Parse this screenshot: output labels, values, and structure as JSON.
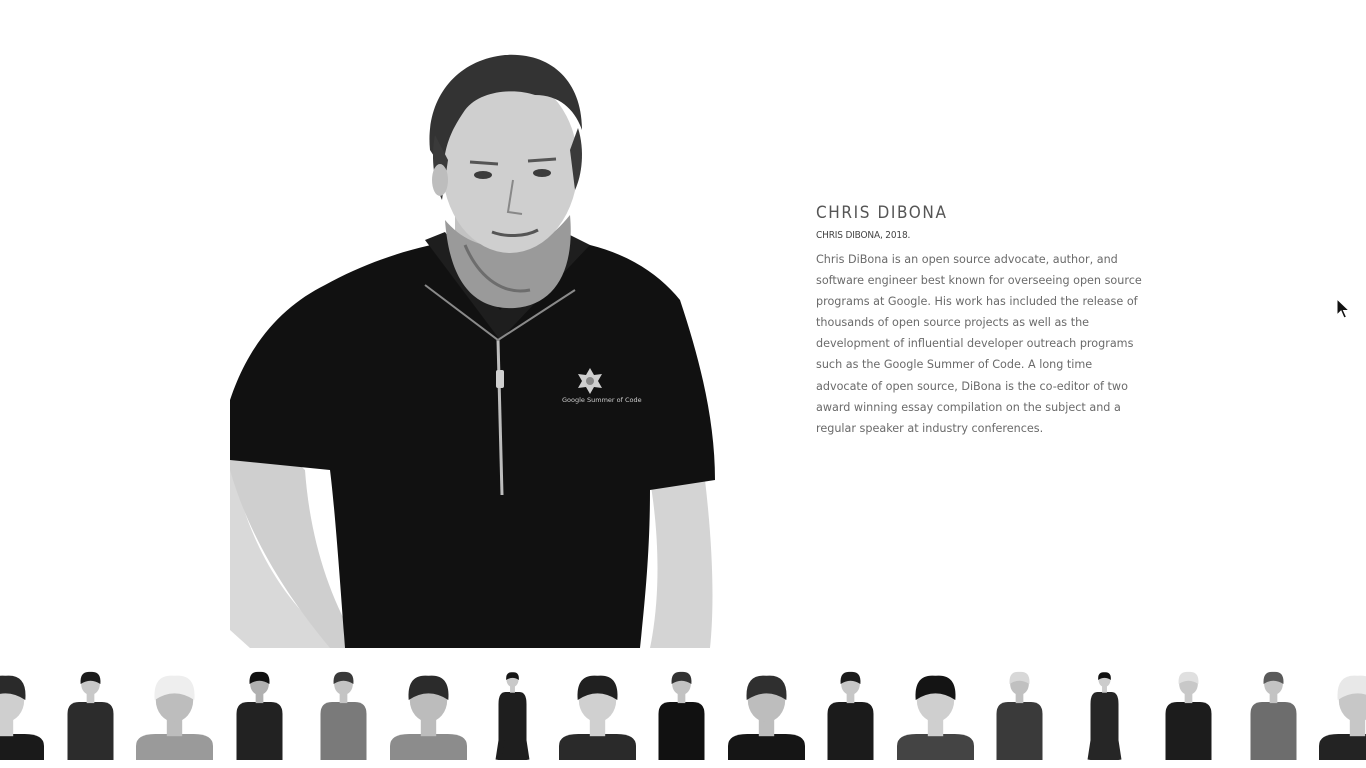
{
  "bio": {
    "name": "CHRIS DIBONA",
    "subtitle": "CHRIS DIBONA, 2018.",
    "description": "Chris DiBona is an open source advocate, author, and software engineer best known for overseeing open source programs at Google. His work has included the release of thousands of open source projects as well as the development of influential developer outreach programs such as the Google Summer of Code. A long time advocate of open source, DiBona is the co-editor of two award winning essay compilation on the subject and a regular speaker at industry conferences."
  },
  "portrait": {
    "shirt_logo_text": "Google Summer of Code"
  },
  "thumbnails": [
    {
      "shirt": "#1a1a1a",
      "hair": "#2a2a2a",
      "skin": "#cfcfcf",
      "framing": "close"
    },
    {
      "shirt": "#2c2c2c",
      "hair": "#1c1c1c",
      "skin": "#c8c8c8",
      "framing": "half"
    },
    {
      "shirt": "#9a9a9a",
      "hair": "#eeeeee",
      "skin": "#bdbdbd",
      "framing": "close"
    },
    {
      "shirt": "#222222",
      "hair": "#111111",
      "skin": "#b0b0b0",
      "framing": "half"
    },
    {
      "shirt": "#7a7a7a",
      "hair": "#3a3a3a",
      "skin": "#c4c4c4",
      "framing": "half"
    },
    {
      "shirt": "#8c8c8c",
      "hair": "#2b2b2b",
      "skin": "#bcbcbc",
      "framing": "close"
    },
    {
      "shirt": "#1e1e1e",
      "hair": "#161616",
      "skin": "#c9c9c9",
      "framing": "full"
    },
    {
      "shirt": "#2a2a2a",
      "hair": "#202020",
      "skin": "#d0d0d0",
      "framing": "close"
    },
    {
      "shirt": "#111111",
      "hair": "#333333",
      "skin": "#c2c2c2",
      "framing": "half"
    },
    {
      "shirt": "#151515",
      "hair": "#2f2f2f",
      "skin": "#bdbdbd",
      "framing": "close"
    },
    {
      "shirt": "#1b1b1b",
      "hair": "#1b1b1b",
      "skin": "#c6c6c6",
      "framing": "half"
    },
    {
      "shirt": "#444444",
      "hair": "#141414",
      "skin": "#cfcfcf",
      "framing": "close"
    },
    {
      "shirt": "#3a3a3a",
      "hair": "#d8d8d8",
      "skin": "#c0c0c0",
      "framing": "half"
    },
    {
      "shirt": "#262626",
      "hair": "#111111",
      "skin": "#cccccc",
      "framing": "full"
    },
    {
      "shirt": "#1c1c1c",
      "hair": "#e0e0e0",
      "skin": "#c8c8c8",
      "framing": "half"
    },
    {
      "shirt": "#6d6d6d",
      "hair": "#5a5a5a",
      "skin": "#c3c3c3",
      "framing": "half"
    },
    {
      "shirt": "#232323",
      "hair": "#e8e8e8",
      "skin": "#c7c7c7",
      "framing": "close"
    }
  ]
}
